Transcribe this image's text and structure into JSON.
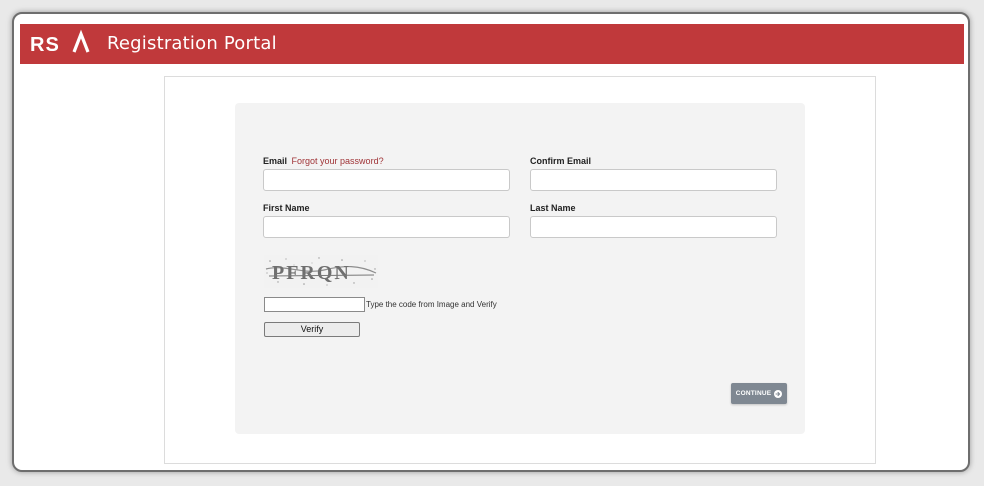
{
  "header": {
    "brand": "RSA",
    "title": "Registration Portal",
    "bar_color": "#c0393b"
  },
  "form": {
    "email_label": "Email",
    "forgot_password_link": "Forgot your password?",
    "confirm_email_label": "Confirm Email",
    "first_name_label": "First Name",
    "last_name_label": "Last Name",
    "email_value": "",
    "confirm_email_value": "",
    "first_name_value": "",
    "last_name_value": "",
    "captcha": {
      "code": "PFRQN",
      "input_value": "",
      "hint": "Type the code from Image and Verify",
      "verify_label": "Verify"
    },
    "continue_label": "CONTINUE",
    "continue_icon": "arrow-right-circle-icon"
  }
}
